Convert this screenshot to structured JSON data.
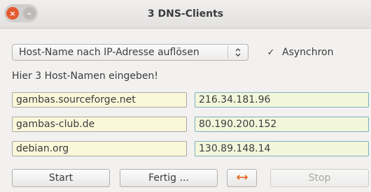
{
  "window": {
    "title": "3 DNS-Clients",
    "close_glyph": "×",
    "minimize_glyph": "–"
  },
  "mode_select": {
    "selected": "Host-Name nach IP-Adresse auflösen"
  },
  "async_checkbox": {
    "label": "Asynchron",
    "checked": true,
    "glyph": "✓"
  },
  "hint": "Hier 3 Host-Namen eingeben!",
  "rows": [
    {
      "host": "gambas.sourceforge.net",
      "ip": "216.34.181.96"
    },
    {
      "host": "gambas-club.de",
      "ip": "80.190.200.152"
    },
    {
      "host": "debian.org",
      "ip": "130.89.148.14"
    }
  ],
  "buttons": {
    "start": "Start",
    "fertig": "Fertig ...",
    "swap_icon": "swap-arrows-icon",
    "stop": "Stop"
  },
  "colors": {
    "close_button": "#e35a31",
    "minimize_button": "#bdbab7",
    "host_field_bg": "#fbf8da",
    "ip_field_bg": "#f2f7dc",
    "swap_arrow": "#e8641b"
  }
}
